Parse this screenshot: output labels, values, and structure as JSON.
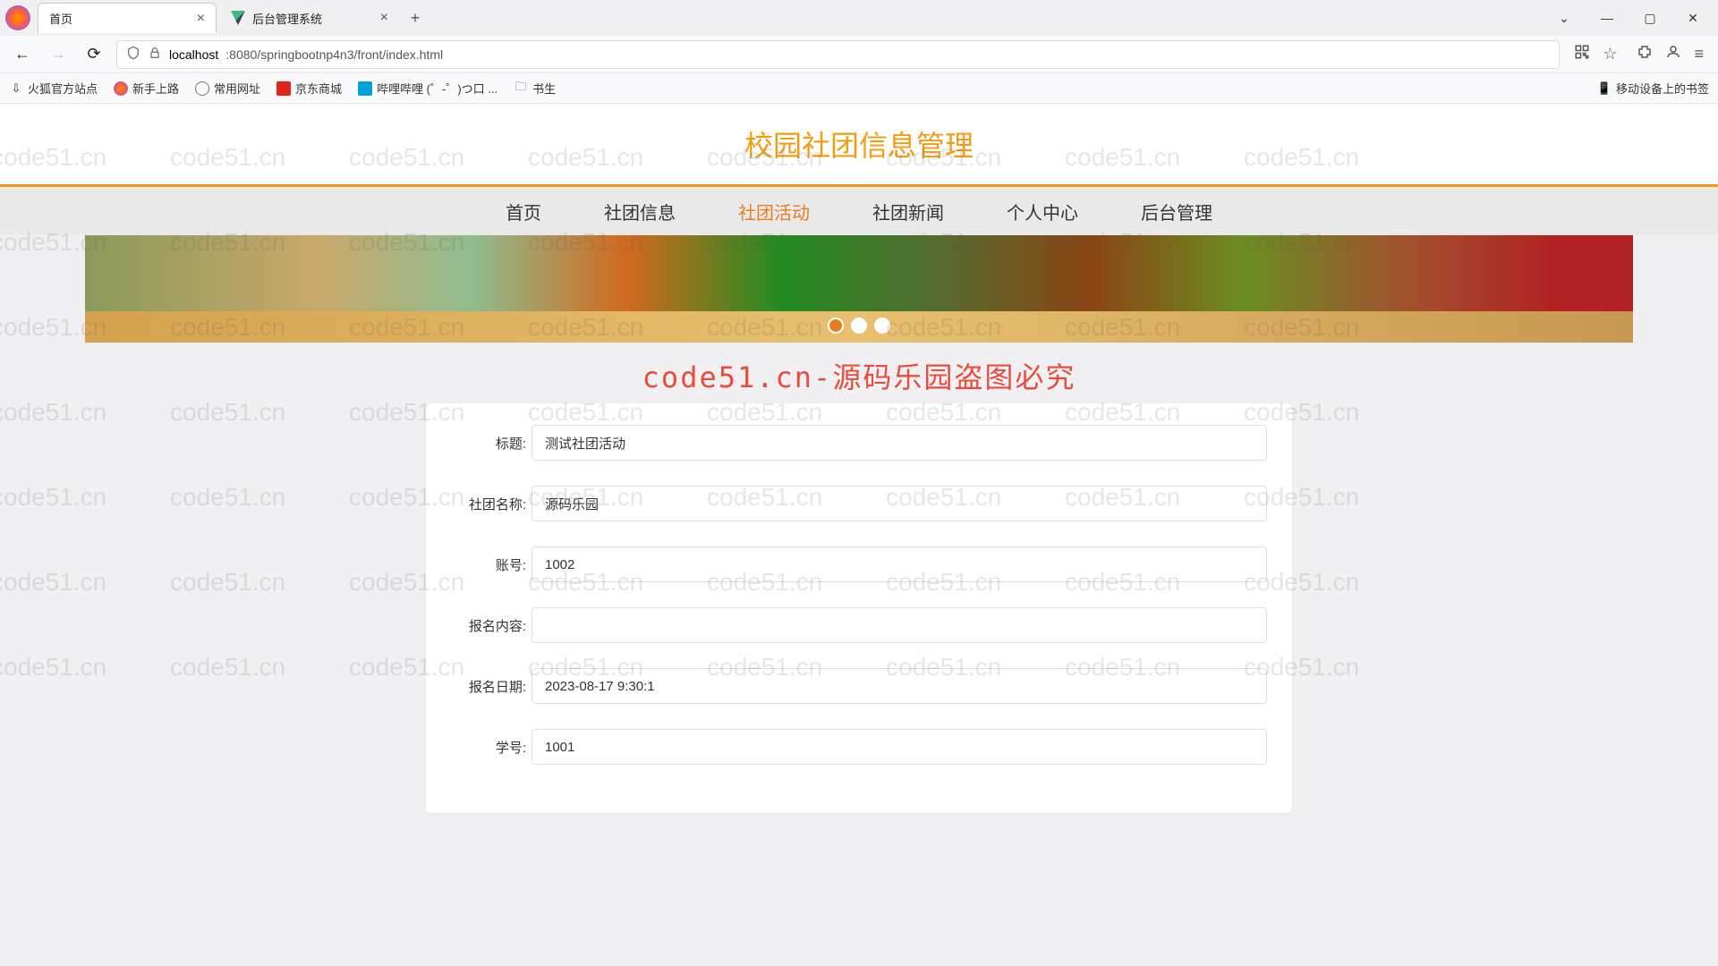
{
  "browser": {
    "tabs": [
      {
        "title": "首页",
        "active": true
      },
      {
        "title": "后台管理系统",
        "active": false
      }
    ],
    "url_prefix": "localhost",
    "url_rest": ":8080/springbootnp4n3/front/index.html",
    "window": {
      "minimize": "—",
      "maximize": "▢",
      "close": "✕",
      "dropdown": "⌄"
    },
    "bookmarks": [
      {
        "label": "火狐官方站点",
        "icon": "import"
      },
      {
        "label": "新手上路",
        "icon": "ff"
      },
      {
        "label": "常用网址",
        "icon": "globe"
      },
      {
        "label": "京东商城",
        "icon": "jd"
      },
      {
        "label": "哔哩哔哩 (゜-゜)つ口 ...",
        "icon": "bili"
      },
      {
        "label": "书生",
        "icon": "folder"
      }
    ],
    "mobile_bookmarks": "移动设备上的书签"
  },
  "site": {
    "title": "校园社团信息管理",
    "nav": [
      "首页",
      "社团信息",
      "社团活动",
      "社团新闻",
      "个人中心",
      "后台管理"
    ],
    "nav_active_index": 2
  },
  "watermark_text": "code51.cn-源码乐园盗图必究",
  "wm_cell": "code51.cn",
  "form": {
    "fields": [
      {
        "label": "标题:",
        "value": "测试社团活动"
      },
      {
        "label": "社团名称:",
        "value": "源码乐园"
      },
      {
        "label": "账号:",
        "value": "1002"
      },
      {
        "label": "报名内容:",
        "value": ""
      },
      {
        "label": "报名日期:",
        "value": "2023-08-17 9:30:1"
      },
      {
        "label": "学号:",
        "value": "1001"
      }
    ]
  }
}
